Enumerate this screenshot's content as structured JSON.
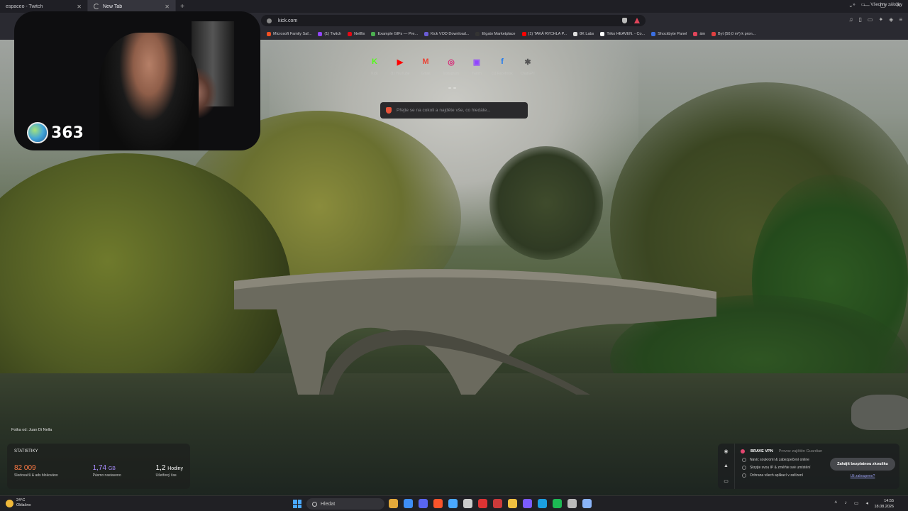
{
  "tabs": [
    {
      "title": "espaceo - Twitch",
      "active": false
    },
    {
      "title": "New Tab",
      "active": true
    }
  ],
  "address_bar": {
    "url": "kick.com"
  },
  "bookmarks": [
    {
      "label": "Microsoft Family Saf...",
      "color": "#f25022"
    },
    {
      "label": "(1) Twitch",
      "color": "#9146ff"
    },
    {
      "label": "Netflix",
      "color": "#e50914"
    },
    {
      "label": "Example GIFs — Pre...",
      "color": "#4caf50"
    },
    {
      "label": "Kick VOD Download...",
      "color": "#6a5cd6"
    },
    {
      "label": "Elgato Marketplace",
      "color": "#333333"
    },
    {
      "label": "(1) TAKÁ RYCHLA P...",
      "color": "#ff0000"
    },
    {
      "label": "8K Labs",
      "color": "#dddddd"
    },
    {
      "label": "Triko HEAVEN. - Co...",
      "color": "#ffffff"
    },
    {
      "label": "Shockbyte Panel",
      "color": "#3b6fe0"
    },
    {
      "label": "ám",
      "color": "#e0455a"
    },
    {
      "label": "Byt (50,0 m²) k pron...",
      "color": "#e04040"
    }
  ],
  "bookmarks_other": "Všechny záložky",
  "webcam": {
    "viewer_count": "363"
  },
  "shortcuts": [
    {
      "icon": "kick-icon",
      "letter": "K",
      "color": "#53fc18",
      "label": "Kick"
    },
    {
      "icon": "youtube-icon",
      "letter": "▶",
      "color": "#ff0000",
      "label": "(1) YouTube"
    },
    {
      "icon": "gmail-icon",
      "letter": "M",
      "color": "#ea4335",
      "label": "Gmail"
    },
    {
      "icon": "instagram-icon",
      "letter": "◎",
      "color": "#d62976",
      "label": "Instagram"
    },
    {
      "icon": "twitch-icon",
      "letter": "▣",
      "color": "#9146ff",
      "label": "Twitch"
    },
    {
      "icon": "facebook-icon",
      "letter": "f",
      "color": "#1877f2",
      "label": "(1) Facebook"
    },
    {
      "icon": "chatgpt-icon",
      "letter": "✱",
      "color": "#555555",
      "label": "ChatGPT"
    }
  ],
  "search": {
    "placeholder": "Přejte se na cokoli a najděte vše, co hledáte..."
  },
  "photo_credit": "Fotka od: Juan Di Nella",
  "stats": {
    "title": "STATISTIKY",
    "items": [
      {
        "value": "82 009",
        "unit": "",
        "desc": "Sledovačů & ads blokováno"
      },
      {
        "value": "1,74",
        "unit": "GB",
        "desc": "Pásmo nastaveno"
      },
      {
        "value": "1,2",
        "unit": "Hodiny",
        "desc": "Ušetřený čas"
      }
    ]
  },
  "vpn": {
    "name": "BRAVE VPN",
    "sub": "Provoz zajištěn Guardian",
    "features": [
      "Navíc soukromí & zabezpečení online",
      "Skryjte svou IP & změňte své umístění",
      "Ochrana všech aplikací v zařízení"
    ],
    "cta": "Zahájit bezplatnou zkoušku",
    "link": "Už zakoupeno?"
  },
  "taskbar": {
    "weather_temp": "24°C",
    "weather_desc": "Oblačno",
    "search_label": "Hledat",
    "time": "14:55",
    "date": "18.08.2026",
    "apps": [
      "#e3a93a",
      "#3e8ef7",
      "#5865f2",
      "#fb542b",
      "#4aa8ff",
      "#cccccc",
      "#dd3333",
      "#cc3a3a",
      "#f0c040",
      "#7b5cff",
      "#1b9ee0",
      "#1db954",
      "#bbbbbb",
      "#8ab4f8"
    ]
  }
}
